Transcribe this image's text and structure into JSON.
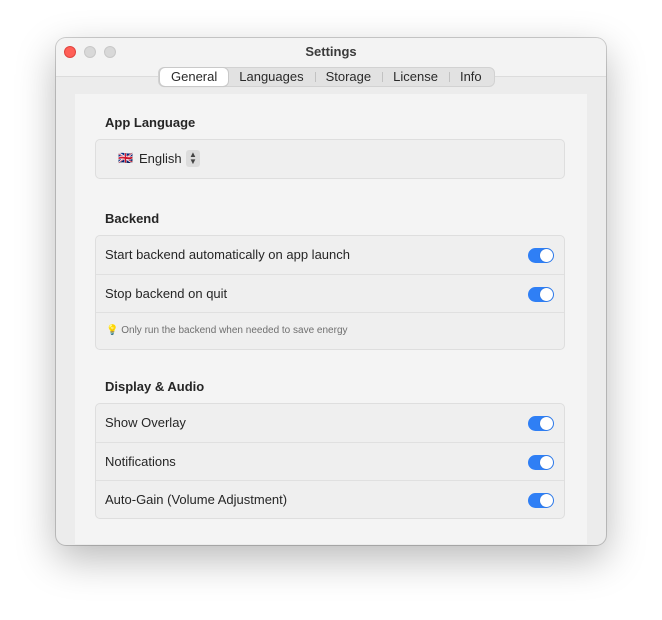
{
  "window": {
    "title": "Settings"
  },
  "tabs": [
    {
      "label": "General",
      "active": true
    },
    {
      "label": "Languages",
      "active": false
    },
    {
      "label": "Storage",
      "active": false
    },
    {
      "label": "License",
      "active": false
    },
    {
      "label": "Info",
      "active": false
    }
  ],
  "app_language": {
    "title": "App Language",
    "flag": "🇬🇧",
    "selected": "English"
  },
  "backend": {
    "title": "Backend",
    "start_label": "Start backend automatically on app launch",
    "start_on": true,
    "stop_label": "Stop backend on quit",
    "stop_on": true,
    "hint": "Only run the backend when needed to save energy"
  },
  "display_audio": {
    "title": "Display & Audio",
    "overlay_label": "Show Overlay",
    "overlay_on": true,
    "notifications_label": "Notifications",
    "notifications_on": true,
    "autogain_label": "Auto-Gain (Volume Adjustment)",
    "autogain_on": true
  },
  "colors": {
    "accent": "#2f7ff5",
    "close": "#ff5f57"
  },
  "icons": {
    "hint": "lightbulb-icon",
    "stepper": "up-down-chevron-icon"
  }
}
